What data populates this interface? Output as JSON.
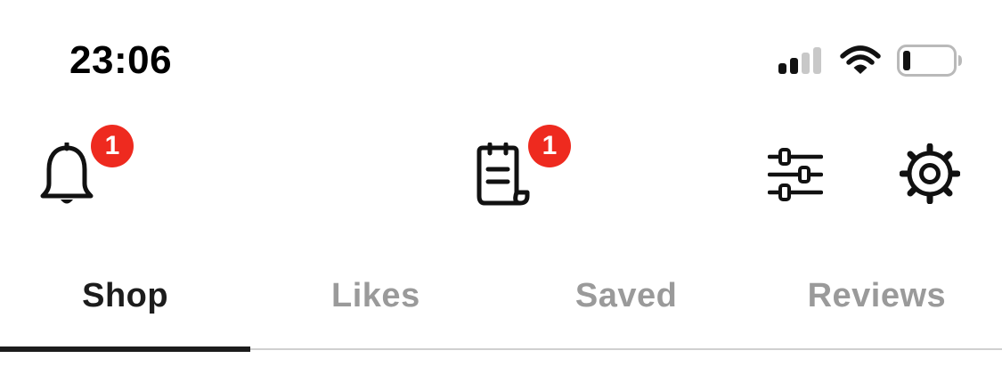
{
  "status_bar": {
    "time": "23:06",
    "icons": [
      "cellular-signal-icon",
      "wifi-icon",
      "battery-icon"
    ],
    "battery_level": 0.15
  },
  "toolbar": {
    "notifications": {
      "icon": "bell-icon",
      "badge_count": "1"
    },
    "orders": {
      "icon": "receipt-icon",
      "badge_count": "1"
    },
    "filters": {
      "icon": "sliders-icon"
    },
    "settings": {
      "icon": "gear-icon"
    }
  },
  "tabs": [
    {
      "label": "Shop",
      "active": true
    },
    {
      "label": "Likes",
      "active": false
    },
    {
      "label": "Saved",
      "active": false
    },
    {
      "label": "Reviews",
      "active": false
    }
  ],
  "colors": {
    "badge": "#ee2a1f",
    "text_active": "#1c1c1c",
    "text_inactive": "#9a9a9a",
    "divider": "#d0d0d0"
  }
}
